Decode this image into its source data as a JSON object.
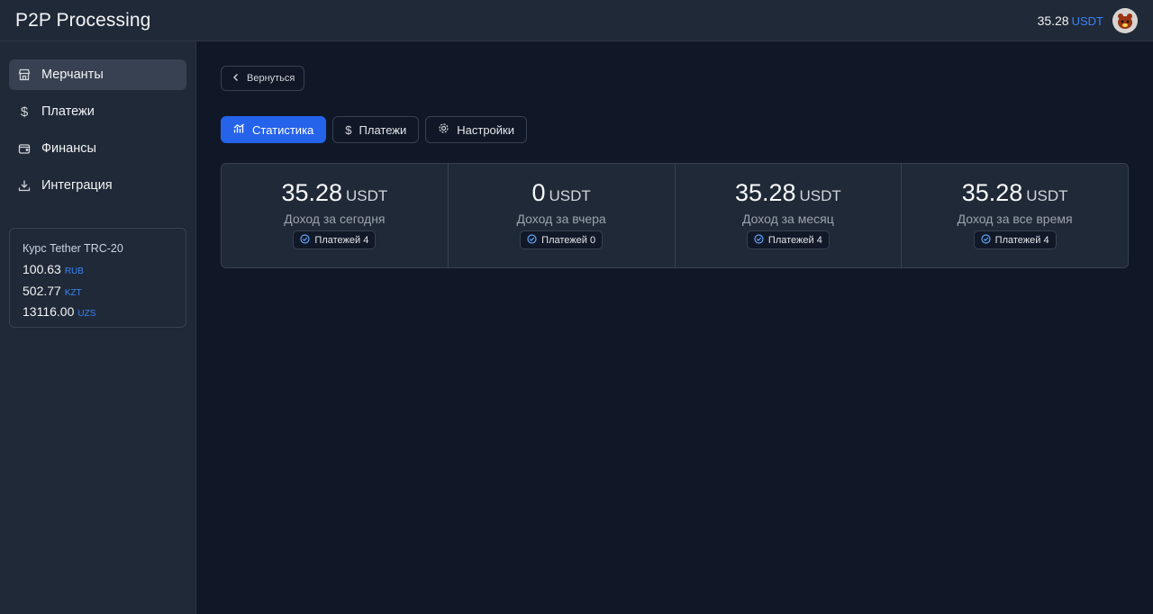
{
  "app": {
    "brand": "P2P Processing",
    "balance_value": "35.28",
    "balance_currency": "USDT",
    "accent_color": "#2563eb"
  },
  "sidebar": {
    "items": [
      {
        "label": "Мерчанты",
        "icon": "store-icon",
        "active": true
      },
      {
        "label": "Платежи",
        "icon": "dollar-icon",
        "active": false
      },
      {
        "label": "Финансы",
        "icon": "wallet-icon",
        "active": false
      },
      {
        "label": "Интеграция",
        "icon": "download-icon",
        "active": false
      }
    ],
    "rates": {
      "title": "Курс Tether TRC-20",
      "rows": [
        {
          "value": "100.63",
          "currency": "RUB"
        },
        {
          "value": "502.77",
          "currency": "KZT"
        },
        {
          "value": "13116.00",
          "currency": "UZS"
        }
      ]
    }
  },
  "main": {
    "back_label": "Вернуться",
    "tabs": [
      {
        "label": "Статистика",
        "icon": "chart-icon",
        "active": true
      },
      {
        "label": "Платежи",
        "icon": "dollar-icon",
        "active": false
      },
      {
        "label": "Настройки",
        "icon": "gear-icon",
        "active": false
      }
    ],
    "stats": [
      {
        "value": "35.28",
        "currency": "USDT",
        "label": "Доход за сегодня",
        "badge": "Платежей 4"
      },
      {
        "value": "0",
        "currency": "USDT",
        "label": "Доход за вчера",
        "badge": "Платежей 0"
      },
      {
        "value": "35.28",
        "currency": "USDT",
        "label": "Доход за месяц",
        "badge": "Платежей 4"
      },
      {
        "value": "35.28",
        "currency": "USDT",
        "label": "Доход за все время",
        "badge": "Платежей 4"
      }
    ]
  }
}
